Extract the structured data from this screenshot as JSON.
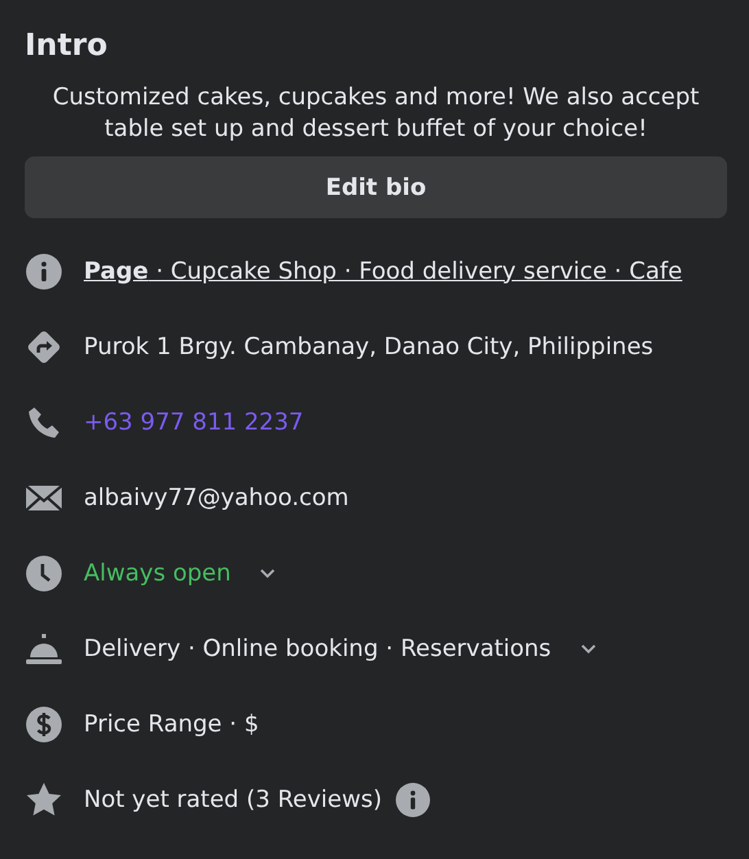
{
  "title": "Intro",
  "bio": "Customized cakes, cupcakes and more! We also accept table set up and dessert buffet of your choice!",
  "edit_button": "Edit bio",
  "items": [
    {
      "kind": "link",
      "text": "**Page** · Cupcake Shop · Food delivery service · Cafe",
      "dropdown": false,
      "info_button": false
    },
    {
      "kind": "plain",
      "text": "Purok 1 Brgy. Cambanay, Danao City, Philippines",
      "dropdown": false,
      "info_button": false
    },
    {
      "kind": "phone",
      "text": "+63 977 811 2237",
      "dropdown": false,
      "info_button": false
    },
    {
      "kind": "plain",
      "text": "albaivy77@yahoo.com",
      "dropdown": false,
      "info_button": false
    },
    {
      "kind": "status",
      "text": "Always open",
      "dropdown": true,
      "info_button": false
    },
    {
      "kind": "plain",
      "text": "Delivery · Online booking · Reservations",
      "dropdown": true,
      "info_button": false
    },
    {
      "kind": "plain",
      "text": "Price Range · $",
      "dropdown": false,
      "info_button": false
    },
    {
      "kind": "plain",
      "text": "Not yet rated (3 Reviews)",
      "dropdown": false,
      "info_button": true
    }
  ]
}
